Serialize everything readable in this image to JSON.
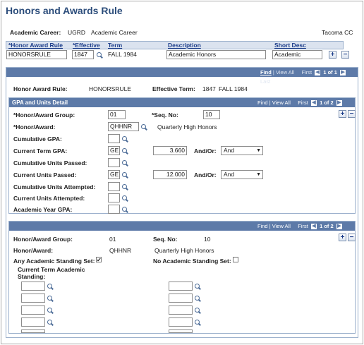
{
  "page": {
    "title": "Honors and Awards Rule"
  },
  "header": {
    "career_label": "Academic Career:",
    "career_code": "UGRD",
    "career_desc": "Academic Career",
    "institution": "Tacoma CC"
  },
  "key_grid": {
    "col_rule": "*Honor Award Rule",
    "col_effective": "*Effective",
    "col_term": "Term",
    "col_description": "Description",
    "col_short_desc": "Short Desc",
    "rule_value": "HONORSRULE",
    "effective_value": "1847",
    "term_value": "FALL 1984",
    "description_value": "Academic Honors",
    "short_desc_value": "Academic",
    "add_label": "+",
    "remove_label": "−"
  },
  "rule_nav": {
    "find": "Find",
    "view_all": "View All",
    "first": "First",
    "range": "1 of 1",
    "last": "Last",
    "sep": "|"
  },
  "rule_info": {
    "rule_label": "Honor Award Rule:",
    "rule_value": "HONORSRULE",
    "term_label": "Effective Term:",
    "term_code": "1847",
    "term_desc": "FALL 1984"
  },
  "gpa_section": {
    "title": "GPA and Units Detail",
    "nav": {
      "find": "Find",
      "view_all": "View All",
      "first": "First",
      "range": "1 of 2",
      "last": "Last",
      "sep": "|"
    },
    "group_label": "*Honor/Award Group:",
    "group_value": "01",
    "seq_label": "*Seq. No:",
    "seq_value": "10",
    "award_label": "*Honor/Award:",
    "award_value": "QHHNR",
    "award_desc": "Quarterly High Honors",
    "cum_gpa_label": "Cumulative GPA:",
    "cur_gpa_label": "Current Term GPA:",
    "cur_gpa_op": "GE",
    "cur_gpa_value": "3.660",
    "andor_label": "And/Or:",
    "andor_value_1": "And",
    "cum_units_label": "Cumulative Units Passed:",
    "cur_units_label": "Current Units Passed:",
    "cur_units_op": "GE",
    "cur_units_value": "12.000",
    "andor_value_2": "And",
    "cum_att_label": "Cumulative Units Attempted:",
    "cur_att_label": "Current Units Attempted:",
    "ay_gpa_label": "Academic Year GPA:",
    "add_label": "+",
    "remove_label": "−"
  },
  "standing_section": {
    "nav": {
      "find": "Find",
      "view_all": "View All",
      "first": "First",
      "range": "1 of 2",
      "last": "Last",
      "sep": "|"
    },
    "group_label": "Honor/Award Group:",
    "group_value": "01",
    "seq_label": "Seq. No:",
    "seq_value": "10",
    "award_label": "Honor/Award:",
    "award_value": "QHHNR",
    "award_desc": "Quarterly High Honors",
    "any_label": "Any Academic Standing Set:",
    "any_checked": "✔",
    "none_label": "No Academic Standing Set:",
    "current_label_1": "Current Term Academic",
    "current_label_2": "Standing:",
    "add_label": "+",
    "remove_label": "−"
  },
  "icons": {
    "lookup": "magnifier-icon",
    "prev": "arrow-left-icon",
    "next": "arrow-right-icon"
  },
  "colors": {
    "title": "#2c4d7b",
    "header_bar": "#5d7aa8",
    "grid_header": "#dbe3ef"
  }
}
